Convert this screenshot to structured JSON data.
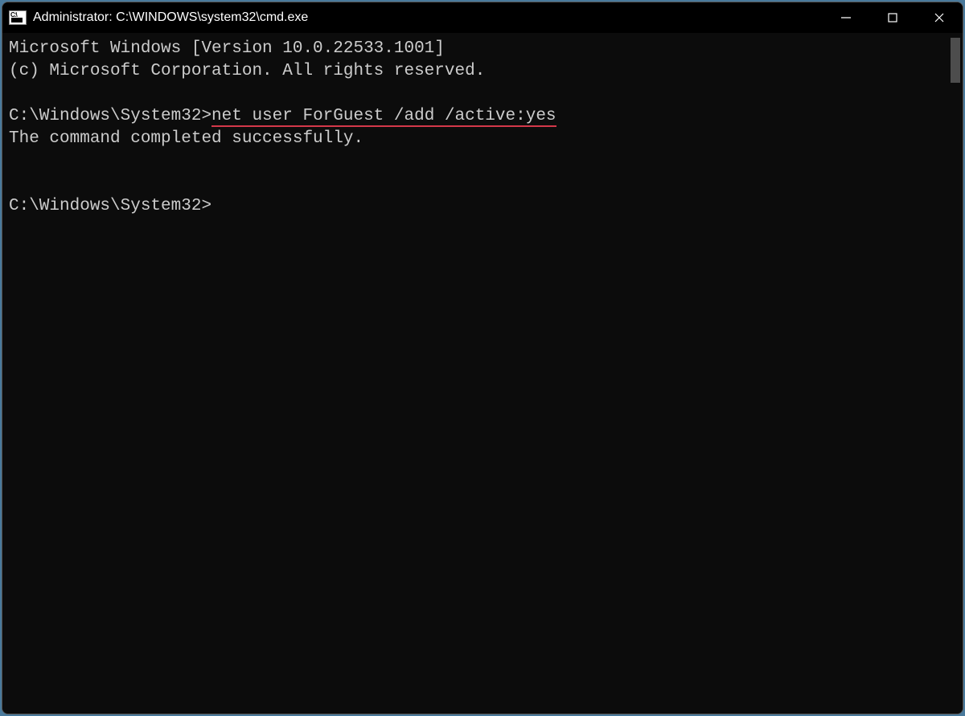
{
  "window": {
    "title": "Administrator: C:\\WINDOWS\\system32\\cmd.exe"
  },
  "terminal": {
    "line1": "Microsoft Windows [Version 10.0.22533.1001]",
    "line2": "(c) Microsoft Corporation. All rights reserved.",
    "blank1": " ",
    "prompt1": "C:\\Windows\\System32>",
    "command1": "net user ForGuest /add /active:yes",
    "result1": "The command completed successfully.",
    "blank2": " ",
    "blank3": " ",
    "prompt2": "C:\\Windows\\System32>"
  },
  "annotation": {
    "underline_color": "#d4384a"
  }
}
